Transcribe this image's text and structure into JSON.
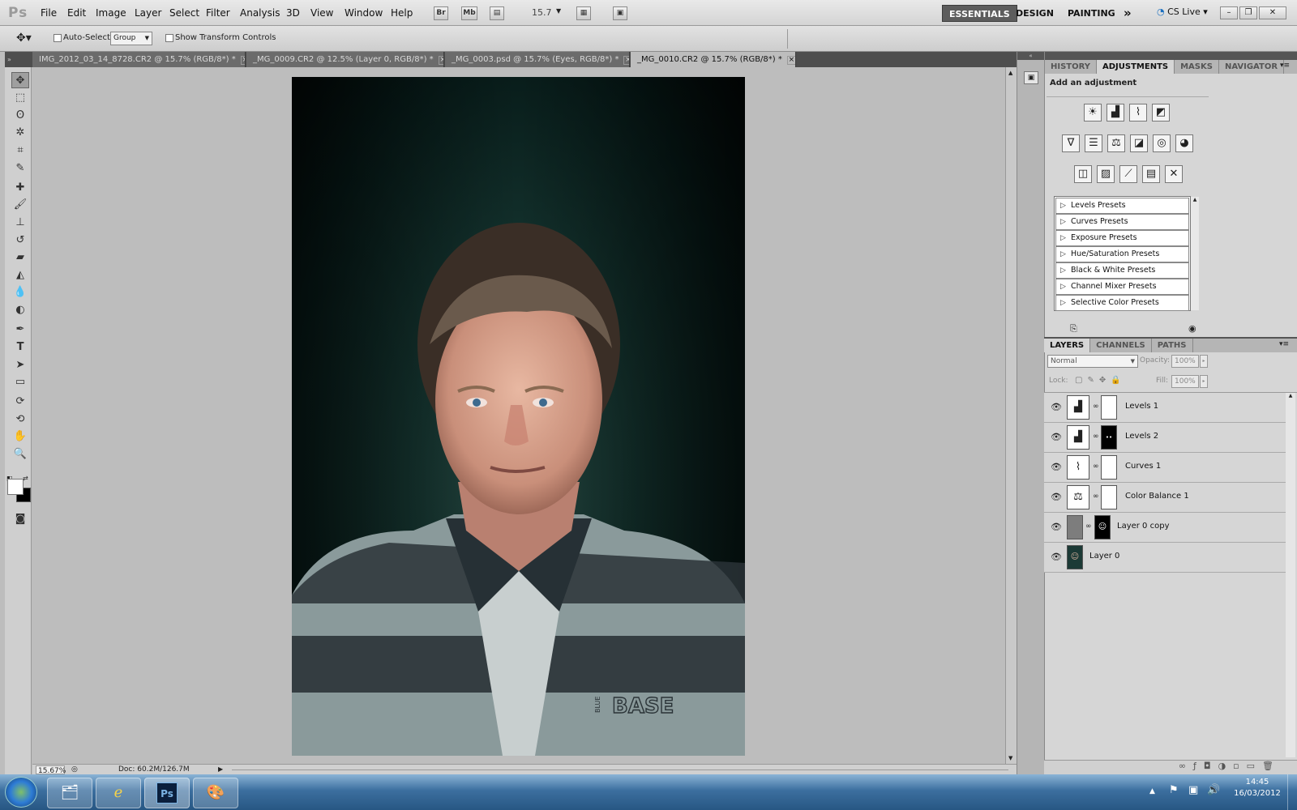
{
  "app": {
    "logo": "Ps",
    "menus": [
      "File",
      "Edit",
      "Image",
      "Layer",
      "Select",
      "Filter",
      "Analysis",
      "3D",
      "View",
      "Window",
      "Help"
    ],
    "bridge_btn": "Br",
    "minibridge_btn": "Mb",
    "zoom_value": "15.7",
    "workspaces": [
      "ESSENTIALS",
      "DESIGN",
      "PAINTING"
    ],
    "more_ws": "»",
    "cs_live": "CS Live"
  },
  "options": {
    "auto_select_label": "Auto-Select:",
    "auto_select_value": "Group",
    "transform_controls_label": "Show Transform Controls"
  },
  "doc_tabs": [
    {
      "label": "IMG_2012_03_14_8728.CR2 @ 15.7% (RGB/8*) *",
      "close": "×"
    },
    {
      "label": "_MG_0009.CR2 @ 12.5% (Layer 0, RGB/8*) *",
      "close": "×"
    },
    {
      "label": "_MG_0003.psd @ 15.7% (Eyes, RGB/8*) *",
      "close": "×"
    },
    {
      "label": "_MG_0010.CR2 @ 15.7% (RGB/8*) *",
      "close": "×"
    }
  ],
  "adjustments_panel": {
    "tabs": [
      "HISTORY",
      "ADJUSTMENTS",
      "MASKS",
      "NAVIGATOR"
    ],
    "heading": "Add an adjustment",
    "presets": [
      "Levels Presets",
      "Curves Presets",
      "Exposure Presets",
      "Hue/Saturation Presets",
      "Black & White Presets",
      "Channel Mixer Presets",
      "Selective Color Presets"
    ]
  },
  "layers_panel": {
    "tabs": [
      "LAYERS",
      "CHANNELS",
      "PATHS"
    ],
    "blend_mode": "Normal",
    "opacity_label": "Opacity:",
    "opacity_value": "100%",
    "lock_label": "Lock:",
    "fill_label": "Fill:",
    "fill_value": "100%",
    "layers": [
      {
        "name": "Levels 1",
        "icon": "levels-icon"
      },
      {
        "name": "Levels 2",
        "icon": "levels-icon"
      },
      {
        "name": "Curves 1",
        "icon": "curves-icon"
      },
      {
        "name": "Color Balance 1",
        "icon": "color-balance-icon"
      },
      {
        "name": "Layer 0 copy",
        "icon": "layer-thumb"
      },
      {
        "name": "Layer 0",
        "icon": "layer-thumb"
      }
    ]
  },
  "status": {
    "zoom": "15.67%",
    "doc": "Doc: 60.2M/126.7M"
  },
  "photo": {
    "logo_text": "BASE",
    "logo_small": "BLUE"
  },
  "taskbar": {
    "time": "14:45",
    "date": "16/03/2012"
  }
}
